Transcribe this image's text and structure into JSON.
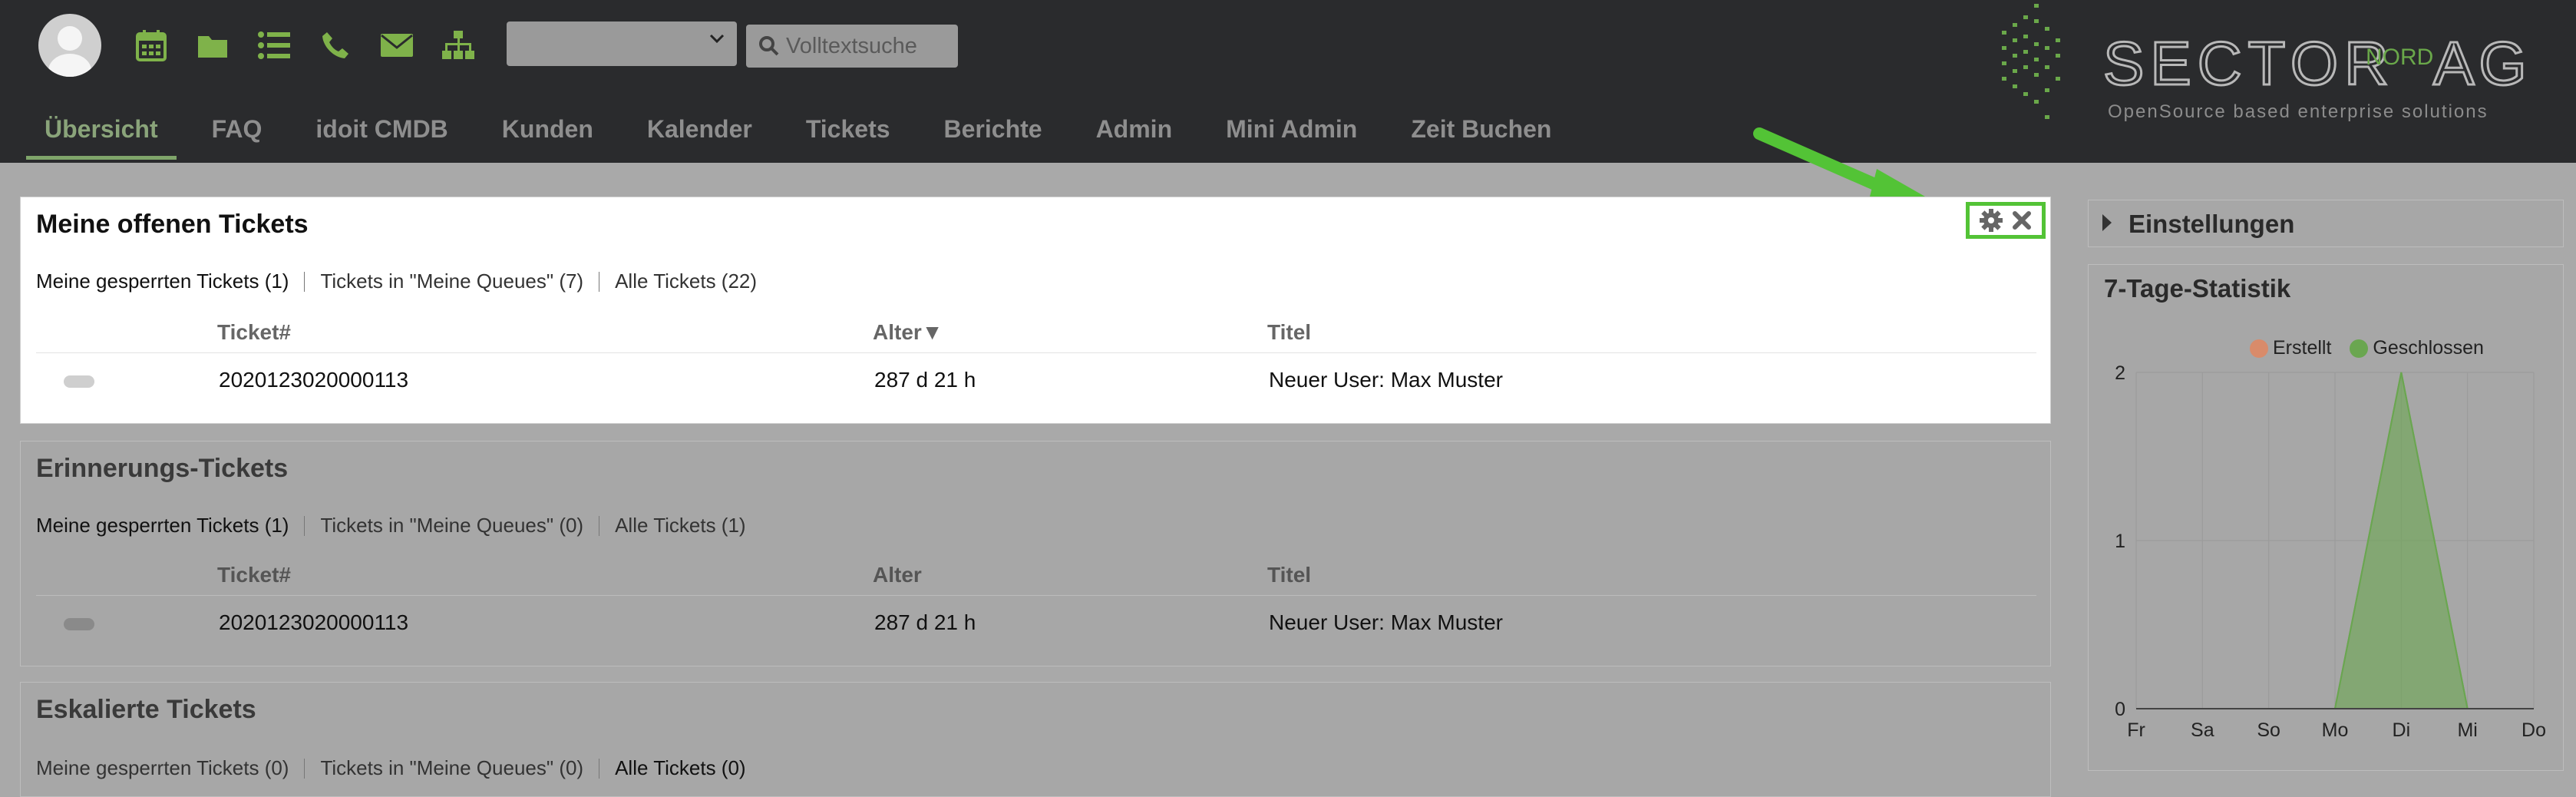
{
  "search": {
    "placeholder": "Volltextsuche"
  },
  "nav": [
    {
      "label": "Übersicht",
      "active": true
    },
    {
      "label": "FAQ"
    },
    {
      "label": "idoit CMDB"
    },
    {
      "label": "Kunden"
    },
    {
      "label": "Kalender"
    },
    {
      "label": "Tickets"
    },
    {
      "label": "Berichte"
    },
    {
      "label": "Admin"
    },
    {
      "label": "Mini Admin"
    },
    {
      "label": "Zeit Buchen"
    }
  ],
  "logo": {
    "word1": "SECTOR",
    "word2": "NORD",
    "word3": "AG",
    "tagline": "OpenSource based enterprise solutions"
  },
  "icons": [
    "calendar-icon",
    "folder-icon",
    "list-icon",
    "phone-icon",
    "envelope-icon",
    "sitemap-icon"
  ],
  "colors": {
    "accent": "#7fa56a",
    "highlight": "#53c336",
    "header_bg": "#2a2b2d",
    "erstellt": "#d98b6a",
    "geschlossen": "#6aa650"
  },
  "columns": {
    "ticket": "Ticket#",
    "age": "Alter",
    "title": "Titel",
    "sort_indicator": "▼"
  },
  "panels": [
    {
      "title": "Meine offenen Tickets",
      "filters": [
        "Meine gesperrten Tickets (1)",
        "Tickets in \"Meine Queues\" (7)",
        "Alle Tickets (22)"
      ],
      "rows": [
        {
          "ticket": "2020123020000113",
          "age": "287 d 21 h",
          "title": "Neuer User: Max Muster"
        }
      ]
    },
    {
      "title": "Erinnerungs-Tickets",
      "filters": [
        "Meine gesperrten Tickets (1)",
        "Tickets in \"Meine Queues\" (0)",
        "Alle Tickets (1)"
      ],
      "rows": [
        {
          "ticket": "2020123020000113",
          "age": "287 d 21 h",
          "title": "Neuer User: Max Muster"
        }
      ]
    },
    {
      "title": "Eskalierte Tickets",
      "filters": [
        "Meine gesperrten Tickets (0)",
        "Tickets in \"Meine Queues\" (0)",
        "Alle Tickets (0)"
      ],
      "rows": []
    }
  ],
  "sidebar": {
    "settings_label": "Einstellungen",
    "stats_title": "7-Tage-Statistik"
  },
  "chart_data": {
    "type": "area",
    "title": "7-Tage-Statistik",
    "categories": [
      "Fr",
      "Sa",
      "So",
      "Mo",
      "Di",
      "Mi",
      "Do"
    ],
    "series": [
      {
        "name": "Erstellt",
        "values": [
          0,
          0,
          0,
          0,
          0,
          0,
          0
        ]
      },
      {
        "name": "Geschlossen",
        "values": [
          0,
          0,
          0,
          0,
          2,
          0,
          0
        ]
      }
    ],
    "yticks": [
      0,
      1,
      2
    ],
    "ylim": [
      0,
      2
    ],
    "grid": true,
    "legend": "top"
  }
}
